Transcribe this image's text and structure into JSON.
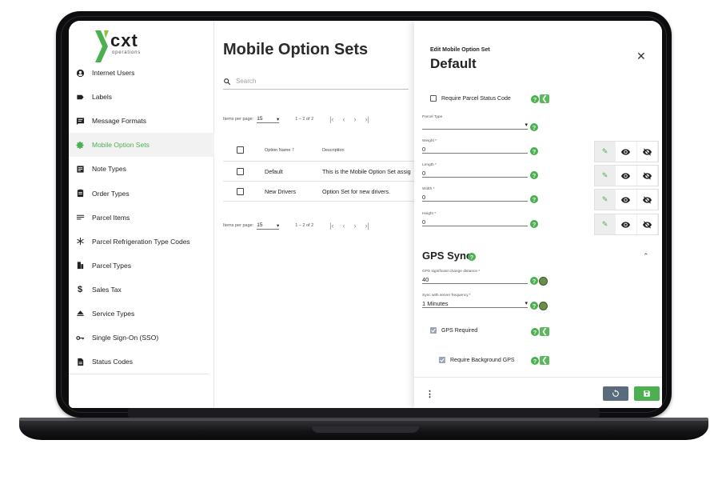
{
  "brand": {
    "logo_text": "cxt",
    "logo_sub": "operations",
    "accent": "#4caf50"
  },
  "sidebar": {
    "items": [
      {
        "label": "Internet Users",
        "icon": "account-circle-icon"
      },
      {
        "label": "Labels",
        "icon": "label-icon"
      },
      {
        "label": "Message Formats",
        "icon": "message-icon"
      },
      {
        "label": "Mobile Option Sets",
        "icon": "gear-icon",
        "active": true
      },
      {
        "label": "Note Types",
        "icon": "note-icon"
      },
      {
        "label": "Order Types",
        "icon": "clipboard-icon"
      },
      {
        "label": "Parcel Items",
        "icon": "list-icon"
      },
      {
        "label": "Parcel Refrigeration Type Codes",
        "icon": "snowflake-icon"
      },
      {
        "label": "Parcel Types",
        "icon": "parcel-icon"
      },
      {
        "label": "Sales Tax",
        "icon": "dollar-icon"
      },
      {
        "label": "Service Types",
        "icon": "eject-icon"
      },
      {
        "label": "Single Sign-On (SSO)",
        "icon": "key-icon"
      },
      {
        "label": "Status Codes",
        "icon": "document-icon"
      }
    ]
  },
  "main": {
    "title": "Mobile Option Sets",
    "search_placeholder": "Search",
    "pager": {
      "items_per_page_label": "Items per page:",
      "items_per_page": "15",
      "range": "1 – 2 of 2"
    },
    "table": {
      "columns": {
        "name": "Option Name",
        "description": "Description"
      },
      "rows": [
        {
          "name": "Default",
          "description": "This is the Mobile Option Set assig"
        },
        {
          "name": "New Drivers",
          "description": "Option Set for new drivers."
        }
      ]
    }
  },
  "panel": {
    "subtitle": "Edit Mobile Option Set",
    "title": "Default",
    "require_parcel_status_code": "Require Parcel Status Code",
    "fields": {
      "parcel_type": {
        "label": "Parcel Type",
        "value": ""
      },
      "weight": {
        "label": "Weight *",
        "value": "0"
      },
      "length": {
        "label": "Length *",
        "value": "0"
      },
      "width": {
        "label": "Width *",
        "value": "0"
      },
      "height": {
        "label": "Height *",
        "value": "0"
      }
    },
    "gps": {
      "section_title": "GPS Sync",
      "distance": {
        "label": "GPS significant change distance *",
        "value": "40"
      },
      "frequency": {
        "label": "Sync with server frequency *",
        "value": "1 Minutes"
      },
      "gps_required": "GPS Required",
      "require_background_gps": "Require Background GPS"
    },
    "help_glyph": "?",
    "close_glyph": "✕",
    "collapse_glyph": "⌃",
    "more_glyph": "⋮"
  }
}
